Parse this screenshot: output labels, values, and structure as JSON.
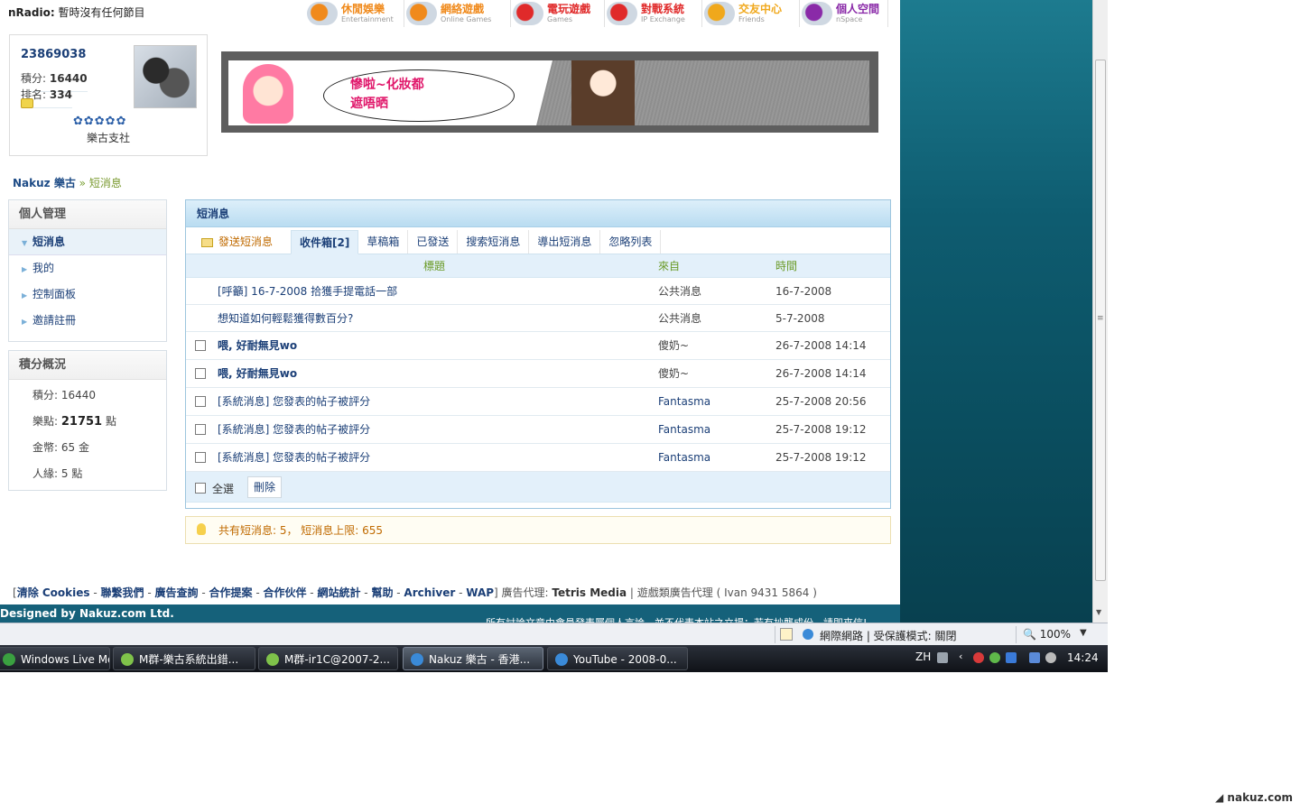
{
  "radio": {
    "label": "nRadio:",
    "status": "暫時沒有任何節目"
  },
  "topnav": [
    {
      "zh": "休閒娛樂",
      "en": "Entertainment",
      "color": "#f08a1c",
      "icon_name": "entertainment-icon"
    },
    {
      "zh": "網絡遊戲",
      "en": "Online Games",
      "color": "#f08a1c",
      "icon_name": "online-games-icon"
    },
    {
      "zh": "電玩遊戲",
      "en": "Games",
      "color": "#e02a2a",
      "icon_name": "games-icon"
    },
    {
      "zh": "對戰系統",
      "en": "IP Exchange",
      "color": "#e02a2a",
      "icon_name": "ip-exchange-icon"
    },
    {
      "zh": "交友中心",
      "en": "Friends",
      "color": "#f0a81c",
      "icon_name": "friends-icon"
    },
    {
      "zh": "個人空間",
      "en": "nSpace",
      "color": "#8a2aa8",
      "icon_name": "nspace-icon"
    }
  ],
  "profile": {
    "uid": "23869038",
    "points_label": "積分:",
    "points": "16440",
    "rank_label": "排名:",
    "rank": "334",
    "stars": "✿✿✿✿✿",
    "group": "樂古支社"
  },
  "banner": {
    "text_line1": "慘啦~化妝都",
    "text_line2": "遮唔晒"
  },
  "breadcrumb": {
    "home": "Nakuz 樂古",
    "sep": "»",
    "current": "短消息"
  },
  "sidebar": {
    "title": "個人管理",
    "items": [
      {
        "label": "短消息",
        "active": true
      },
      {
        "label": "我的",
        "active": false
      },
      {
        "label": "控制面板",
        "active": false
      },
      {
        "label": "邀請註冊",
        "active": false
      }
    ]
  },
  "stats": {
    "title": "積分概況",
    "rows": [
      {
        "label": "積分:",
        "value": "16440",
        "unit": ""
      },
      {
        "label": "樂點:",
        "value": "21751",
        "unit": "點"
      },
      {
        "label": "金幣:",
        "value": "65",
        "unit": "金"
      },
      {
        "label": "人緣:",
        "value": "5",
        "unit": "點"
      }
    ]
  },
  "messages": {
    "panel_title": "短消息",
    "tabs": [
      "發送短消息",
      "收件箱[2]",
      "草稿箱",
      "已發送",
      "搜索短消息",
      "導出短消息",
      "忽略列表"
    ],
    "headers": {
      "subject": "標題",
      "from": "來自",
      "time": "時間"
    },
    "rows": [
      {
        "subject": "[呼籲] 16-7-2008 拾獲手提電話一部",
        "from": "公共消息",
        "time": "16-7-2008",
        "checkbox": false,
        "bold": false,
        "from_link": false
      },
      {
        "subject": "想知道如何輕鬆獲得數百分?",
        "from": "公共消息",
        "time": "5-7-2008",
        "checkbox": false,
        "bold": false,
        "from_link": false
      },
      {
        "subject": "喂, 好耐無見wo",
        "from": "傻奶~",
        "time": "26-7-2008 14:14",
        "checkbox": true,
        "bold": true,
        "from_link": false
      },
      {
        "subject": "喂, 好耐無見wo",
        "from": "傻奶~",
        "time": "26-7-2008 14:14",
        "checkbox": true,
        "bold": true,
        "from_link": false
      },
      {
        "subject": "[系統消息] 您發表的帖子被評分",
        "from": "Fantasma",
        "time": "25-7-2008 20:56",
        "checkbox": true,
        "bold": false,
        "from_link": true
      },
      {
        "subject": "[系統消息] 您發表的帖子被評分",
        "from": "Fantasma",
        "time": "25-7-2008 19:12",
        "checkbox": true,
        "bold": false,
        "from_link": true
      },
      {
        "subject": "[系統消息] 您發表的帖子被評分",
        "from": "Fantasma",
        "time": "25-7-2008 19:12",
        "checkbox": true,
        "bold": false,
        "from_link": true
      }
    ],
    "select_all": "全選",
    "delete": "刪除"
  },
  "notice": "共有短消息: 5， 短消息上限: 655",
  "footer": {
    "links": [
      "清除 Cookies",
      "聯繫我們",
      "廣告查詢",
      "合作提案",
      "合作伙伴",
      "網站統計",
      "幫助",
      "Archiver",
      "WAP"
    ],
    "ad_label": "廣告代理:",
    "ad_company": "Tetris Media",
    "game_ad": "遊戲類廣告代理 ( Ivan 9431 5864 )",
    "designed": "Designed by Nakuz.com Ltd.",
    "disclaimer": "所有討論文章由會員發表屬個人言論，並不代表本站之立場；若有抄襲成份，請即來信!"
  },
  "statusbar": {
    "zone": "網際網路 | 受保護模式: 關閉",
    "zoom": "100%"
  },
  "taskbar": {
    "tasks": [
      {
        "label": "Windows Live Mes...",
        "color": "#3aa040"
      },
      {
        "label": "M群-樂古系統出錯...",
        "color": "#7fc24a"
      },
      {
        "label": "M群-ir1C@2007-2...",
        "color": "#7fc24a"
      },
      {
        "label": "Nakuz 樂古 - 香港...",
        "color": "#3a8ad8"
      },
      {
        "label": "YouTube - 2008-0...",
        "color": "#3a8ad8"
      }
    ],
    "lang": "ZH",
    "clock": "14:24"
  },
  "watermark": "nakuz.com"
}
